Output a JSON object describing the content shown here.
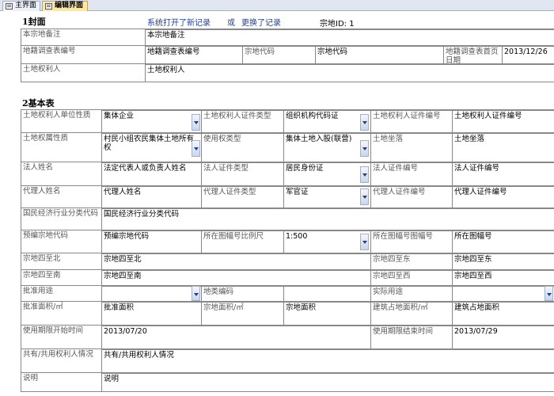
{
  "tabs": [
    {
      "label": "主界面"
    },
    {
      "label": "编辑界面"
    }
  ],
  "header": {
    "section1": "1封面",
    "opened_text": "系统打开了新记录",
    "or_text": "或",
    "changed_text": "更换了记录",
    "parcel_id": "宗地ID: 1"
  },
  "cover": {
    "remark_label": "本宗地备注",
    "remark_value": "本宗地备注",
    "survey_no_label": "地籍调查表编号",
    "survey_no_value": "地籍调查表编号",
    "parcel_code_label": "宗地代码",
    "parcel_code_value": "宗地代码",
    "first_date_label": "地籍调查表首页日期",
    "first_date_value": "2013/12/26",
    "owner_label": "土地权利人",
    "owner_value": "土地权利人"
  },
  "basic": {
    "section": "2基本表",
    "unit_type_label": "土地权利人单位性质",
    "unit_type_value": "集体企业",
    "cert_type_label": "土地权利人证件类型",
    "cert_type_value": "组织机构代码证",
    "cert_no_label": "土地权利人证件编号",
    "cert_no_value": "土地权利人证件编号",
    "ownership_label": "土地权属性质",
    "ownership_value": "村民小组农民集体土地所有权",
    "use_type_label": "使用权类型",
    "use_type_value": "集体土地入股(联营)",
    "location_label": "土地坐落",
    "location_value": "土地坐落",
    "legal_name_label": "法人姓名",
    "legal_name_value": "法定代表人或负责人姓名",
    "legal_cert_type_label": "法人证件类型",
    "legal_cert_type_value": "居民身份证",
    "legal_cert_no_label": "法人证件编号",
    "legal_cert_no_value": "法人证件编号",
    "agent_name_label": "代理人姓名",
    "agent_name_value": "代理人姓名",
    "agent_cert_type_label": "代理人证件类型",
    "agent_cert_type_value": "军官证",
    "agent_cert_no_label": "代理人证件编号",
    "agent_cert_no_value": "代理人证件编号",
    "industry_label": "国民经济行业分类代码",
    "industry_value": "国民经济行业分类代码",
    "pre_code_label": "预编宗地代码",
    "pre_code_value": "预编宗地代码",
    "scale_label": "所在图幅号比例尺",
    "scale_value": "1:500",
    "sheet_no_label": "所在图幅号图幅号",
    "sheet_no_value": "所在图幅号",
    "north_label": "宗地四至北",
    "north_value": "宗地四至北",
    "east_label": "宗地四至东",
    "east_value": "宗地四至东",
    "south_label": "宗地四至南",
    "south_value": "宗地四至南",
    "west_label": "宗地四至西",
    "west_value": "宗地四至西",
    "approved_use_label": "批准用途",
    "approved_use_value": "",
    "class_code_label": "地类编码",
    "class_code_value": "",
    "actual_use_label": "实际用途",
    "actual_use_value": "",
    "approved_area_label": "批准面积/㎡",
    "approved_area_value": "批准面积",
    "parcel_area_label": "宗地面积/㎡",
    "parcel_area_value": "宗地面积",
    "building_area_label": "建筑占地面积/㎡",
    "building_area_value": "建筑占地面积",
    "start_label": "使用期限开始时间",
    "start_value": "2013/07/20",
    "end_label": "使用期限结束时间",
    "end_value": "2013/07/29",
    "shared_label": "共有/共用权利人情况",
    "shared_value": "共有/共用权利人情况",
    "note_label": "说明",
    "note_value": "说明"
  }
}
